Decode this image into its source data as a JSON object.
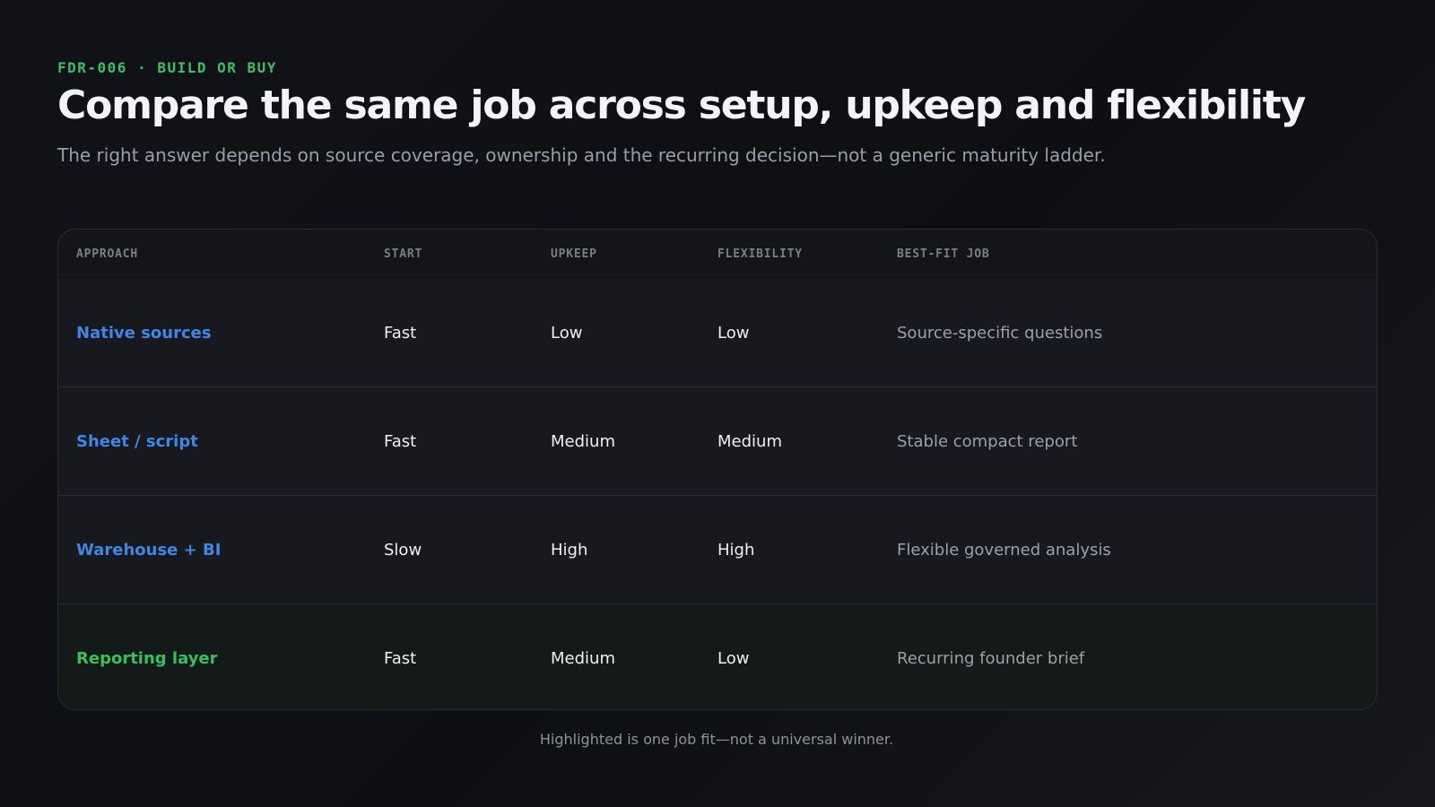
{
  "header": {
    "eyebrow": "FDR-006 · BUILD OR BUY",
    "title": "Compare the same job across setup, upkeep and flexibility",
    "subtitle": "The right answer depends on source coverage, ownership and the recurring decision—not a generic maturity ladder."
  },
  "table": {
    "columns": [
      "APPROACH",
      "START",
      "UPKEEP",
      "FLEXIBILITY",
      "BEST-FIT JOB"
    ],
    "rows": [
      {
        "approach": "Native sources",
        "start": "Fast",
        "upkeep": "Low",
        "flexibility": "Low",
        "best_fit": "Source-specific questions",
        "highlighted": false
      },
      {
        "approach": "Sheet / script",
        "start": "Fast",
        "upkeep": "Medium",
        "flexibility": "Medium",
        "best_fit": "Stable compact report",
        "highlighted": false
      },
      {
        "approach": "Warehouse + BI",
        "start": "Slow",
        "upkeep": "High",
        "flexibility": "High",
        "best_fit": "Flexible governed analysis",
        "highlighted": false
      },
      {
        "approach": "Reporting layer",
        "start": "Fast",
        "upkeep": "Medium",
        "flexibility": "Low",
        "best_fit": "Recurring founder brief",
        "highlighted": true
      }
    ]
  },
  "footnote": "Highlighted is one job fit—not a universal winner.",
  "colors": {
    "accent_green": "#36c05e",
    "accent_blue": "#3e87e6",
    "background": "#111318"
  }
}
